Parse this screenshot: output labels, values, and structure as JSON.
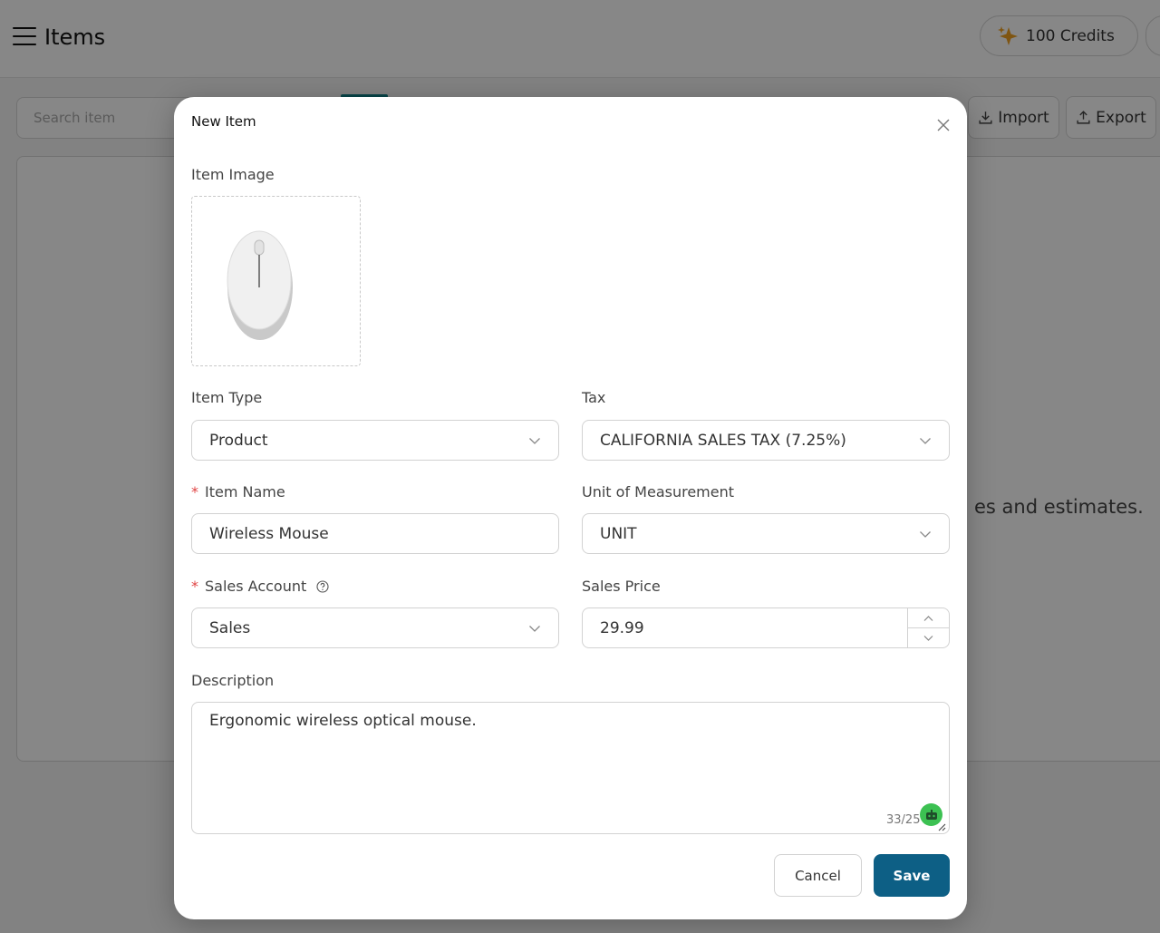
{
  "header": {
    "title": "Items",
    "credits_label": "100 Credits"
  },
  "toolbar": {
    "search_placeholder": "Search item",
    "import_label": "Import",
    "export_label": "Export"
  },
  "background": {
    "empty_text": "es and estimates."
  },
  "modal": {
    "title": "New Item",
    "image_label": "Item Image",
    "item_type": {
      "label": "Item Type",
      "value": "Product"
    },
    "tax": {
      "label": "Tax",
      "value": "CALIFORNIA SALES TAX (7.25%)"
    },
    "item_name": {
      "label": "Item Name",
      "value": "Wireless Mouse"
    },
    "unit": {
      "label": "Unit of Measurement",
      "value": "UNIT"
    },
    "sales_account": {
      "label": "Sales Account",
      "value": "Sales"
    },
    "sales_price": {
      "label": "Sales Price",
      "value": "29.99"
    },
    "description": {
      "label": "Description",
      "value": "Ergonomic wireless optical mouse.",
      "counter": "33/25"
    },
    "cancel_label": "Cancel",
    "save_label": "Save"
  },
  "colors": {
    "primary": "#0d5f85",
    "required": "#e04444",
    "assistant_badge": "#3cc152",
    "credits_icon": "#f0a020"
  }
}
